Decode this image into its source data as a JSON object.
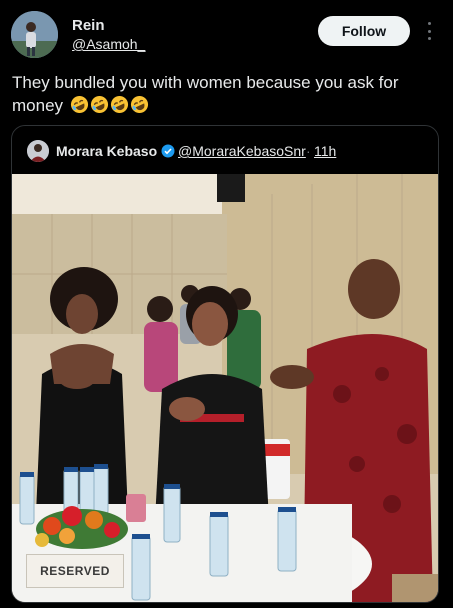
{
  "author": {
    "name": "Rein",
    "handle": "@Asamoh_"
  },
  "follow_label": "Follow",
  "more_icon": "more-vertical-icon",
  "tweet": {
    "text": "They bundled you with women because you ask for money",
    "emojis": [
      "rolling-on-floor-laughing-emoji",
      "rolling-on-floor-laughing-emoji",
      "rolling-on-floor-laughing-emoji",
      "rolling-on-floor-laughing-emoji"
    ]
  },
  "quoted": {
    "name": "Morara Kebaso",
    "verified": true,
    "handle": "@MoraraKebasoSnr",
    "separator": "·",
    "time": "11h"
  },
  "photo": {
    "reserved_card": "RESERVED"
  },
  "colors": {
    "background": "#000000",
    "text": "#e7e9ea",
    "muted": "#71767b",
    "verified": "#1d9bf0",
    "follow_bg": "#eff3f4"
  }
}
